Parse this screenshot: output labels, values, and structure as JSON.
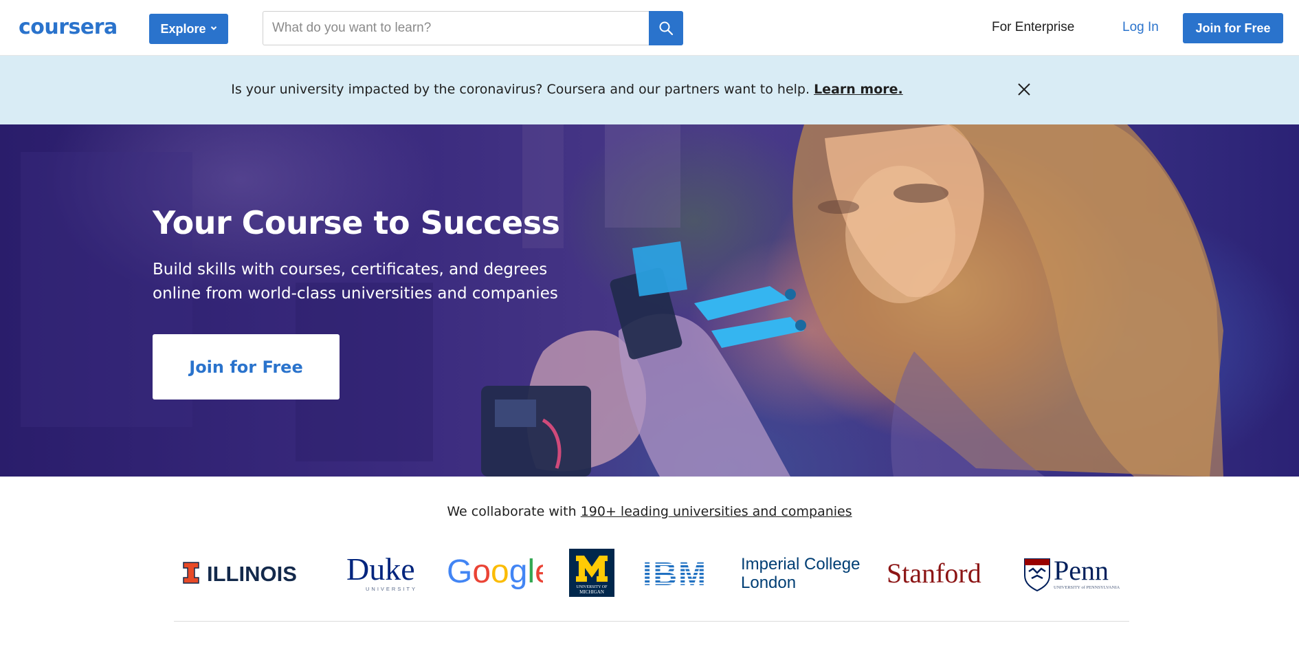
{
  "header": {
    "logo_text": "coursera",
    "explore_label": "Explore",
    "search_placeholder": "What do you want to learn?",
    "for_enterprise": "For Enterprise",
    "log_in": "Log In",
    "join_label": "Join for Free"
  },
  "banner": {
    "message": "Is your university impacted by the coronavirus? Coursera and our partners want to help.",
    "link": "Learn more."
  },
  "hero": {
    "title": "Your Course to Success",
    "subtitle_line1": "Build skills with courses, certificates, and degrees",
    "subtitle_line2": "online from world-class universities and companies",
    "cta": "Join for Free"
  },
  "partners": {
    "intro": "We collaborate with",
    "link": "190+ leading universities and companies",
    "logos": {
      "illinois": "ILLINOIS",
      "duke": "Duke",
      "duke_sub": "UNIVERSITY",
      "google": [
        "G",
        "o",
        "o",
        "g",
        "l",
        "e"
      ],
      "michigan_sub1": "UNIVERSITY OF",
      "michigan_sub2": "MICHIGAN",
      "ibm": "IBM",
      "imperial_line1": "Imperial College",
      "imperial_line2": "London",
      "stanford": "Stanford",
      "penn": "Penn",
      "penn_sub": "UNIVERSITY of PENNSYLVANIA"
    }
  },
  "colors": {
    "brand_blue": "#2a73cc",
    "banner_bg": "#d9ecf5",
    "google_blue": "#4285F4",
    "google_red": "#EA4335",
    "google_yellow": "#FBBC05",
    "google_green": "#34A853",
    "illinois_orange": "#e84a27",
    "michigan_blue": "#00274c",
    "michigan_maize": "#ffcb05",
    "stanford_red": "#8c1515",
    "penn_blue": "#011f5b",
    "imperial_blue": "#003e74",
    "ibm_blue": "#1f70c1"
  }
}
